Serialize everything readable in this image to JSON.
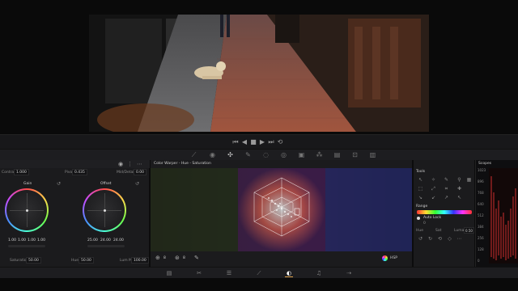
{
  "transport": {
    "controls": [
      {
        "name": "skip-back",
        "glyph": "⏮"
      },
      {
        "name": "step-back",
        "glyph": "◀"
      },
      {
        "name": "stop",
        "glyph": "■"
      },
      {
        "name": "play",
        "glyph": "▶"
      },
      {
        "name": "skip-forward",
        "glyph": "⏭"
      },
      {
        "name": "loop",
        "glyph": "⟲"
      }
    ]
  },
  "toolbar": {
    "icons": [
      "curves-icon",
      "camera-icon",
      "warper-icon",
      "picker-icon",
      "window-icon",
      "tracker-icon",
      "magic-mask-icon",
      "blur-icon",
      "key-icon",
      "sizing-icon",
      "3d-icon"
    ]
  },
  "wheels": {
    "contrast_label": "Contrast",
    "contrast_value": "1.000",
    "pivot_label": "Pivot",
    "pivot_value": "0.435",
    "middetail_label": "Mid/Detail",
    "middetail_value": "0.00",
    "gain": {
      "title": "Gain",
      "values": [
        "1.00",
        "1.00",
        "1.00",
        "1.00"
      ]
    },
    "offset": {
      "title": "Offset",
      "values": [
        "25.00",
        "24.00",
        "24.00"
      ]
    },
    "saturation_label": "Saturation",
    "saturation_value": "50.00",
    "hue_label": "Hue",
    "hue_value": "50.00",
    "lummix_label": "Lum Mix",
    "lummix_value": "100.00"
  },
  "warper": {
    "title": "Color Warper - Hue - Saturation",
    "footer": {
      "zoom_value": "8",
      "resolution_value": "8",
      "colorspace_value": "HSP"
    }
  },
  "tools": {
    "title": "Tools",
    "range_label": "Range",
    "autolock_label": "Auto Lock",
    "autolock_sub": "0",
    "hue_label": "Hue",
    "sat_label": "Sat",
    "luma_label": "Luma",
    "luma_value": "0.50",
    "range_gradient": "rainbow"
  },
  "scopes": {
    "title": "Scopes",
    "scale": [
      "1023",
      "896",
      "768",
      "640",
      "512",
      "384",
      "256",
      "128",
      "0"
    ]
  },
  "bottomnav": {
    "items": [
      "media-icon",
      "cut-icon",
      "edit-icon",
      "fusion-icon",
      "color-icon",
      "fairlight-icon",
      "deliver-icon"
    ]
  }
}
